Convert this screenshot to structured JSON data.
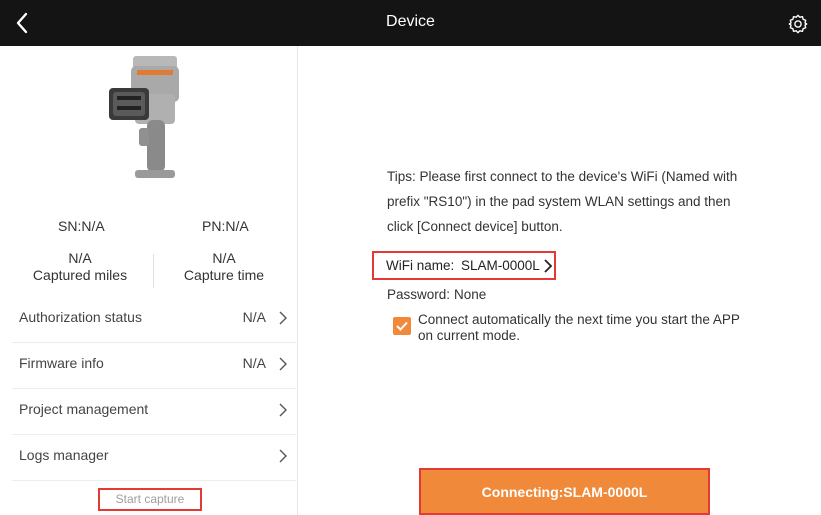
{
  "header": {
    "title": "Device"
  },
  "device": {
    "sn_label": "SN:N/A",
    "pn_label": "PN:N/A",
    "captured_miles_value": "N/A",
    "captured_miles_label": "Captured miles",
    "capture_time_value": "N/A",
    "capture_time_label": "Capture time"
  },
  "menu": [
    {
      "label": "Authorization status",
      "value": "N/A"
    },
    {
      "label": "Firmware info",
      "value": "N/A"
    },
    {
      "label": "Project management",
      "value": ""
    },
    {
      "label": "Logs manager",
      "value": ""
    }
  ],
  "start_capture_label": "Start capture",
  "connection": {
    "tips": "Tips: Please first connect to the device's WiFi (Named with prefix \"RS10\") in the pad system WLAN settings and then click [Connect device] button.",
    "wifi_label": "WiFi name:",
    "wifi_name": "SLAM-0000L",
    "password_label": "Password:",
    "password_value": "None",
    "auto_connect_text": "Connect automatically the next time you start the APP on current mode.",
    "auto_connect_checked": true,
    "connect_button_label": "Connecting:SLAM-0000L"
  },
  "colors": {
    "accent": "#f08a3a",
    "highlight_border": "#e53935",
    "header_bg": "#141414"
  },
  "icons": {
    "back": "chevron-left-icon",
    "settings": "gear-icon",
    "menu_chevron": "chevron-right-icon",
    "checkbox": "check-icon"
  }
}
